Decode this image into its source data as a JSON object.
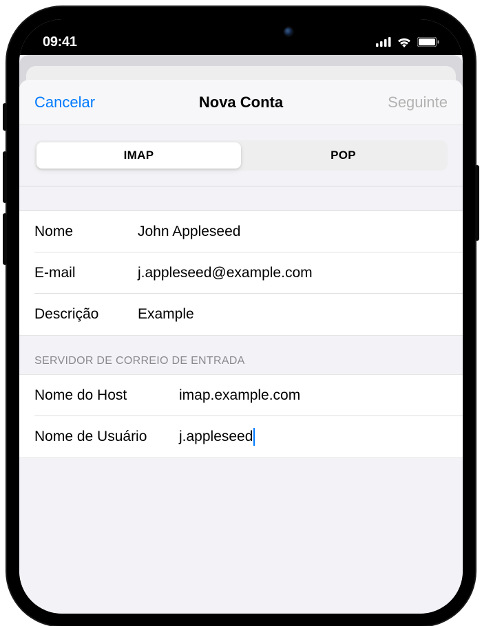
{
  "status": {
    "time": "09:41"
  },
  "nav": {
    "cancel": "Cancelar",
    "title": "Nova Conta",
    "next": "Seguinte"
  },
  "segments": {
    "imap": "IMAP",
    "pop": "POP"
  },
  "account": {
    "name_label": "Nome",
    "name_value": "John Appleseed",
    "email_label": "E-mail",
    "email_value": "j.appleseed@example.com",
    "description_label": "Descrição",
    "description_value": "Example"
  },
  "incoming": {
    "section_title": "SERVIDOR DE CORREIO DE ENTRADA",
    "host_label": "Nome do Host",
    "host_value": "imap.example.com",
    "username_label": "Nome de Usuário",
    "username_value": "j.appleseed"
  }
}
